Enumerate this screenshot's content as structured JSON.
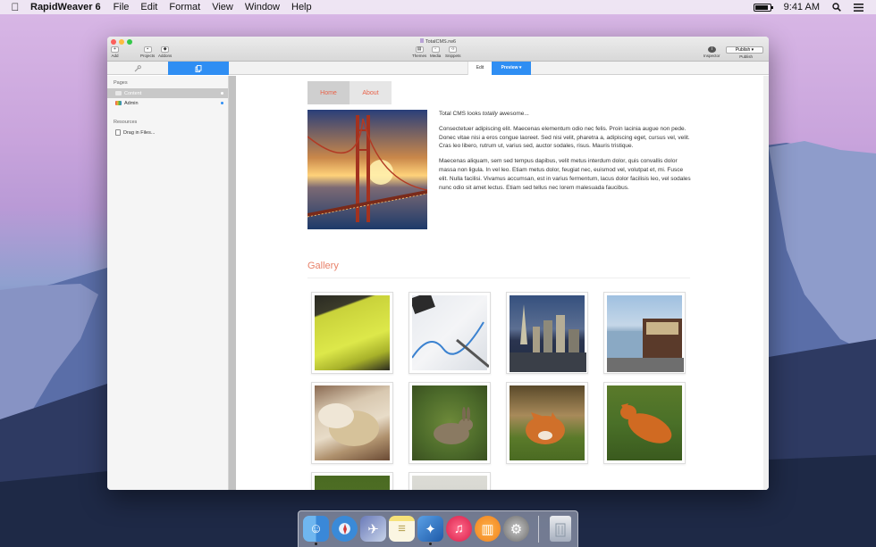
{
  "menubar": {
    "app_name": "RapidWeaver 6",
    "menus": [
      "File",
      "Edit",
      "Format",
      "View",
      "Window",
      "Help"
    ],
    "time": "9:41 AM"
  },
  "window": {
    "document_title": "TotalCMS.rw6",
    "toolbar_left": [
      {
        "label": "Add",
        "icon": "plus-icon"
      },
      {
        "label": "Projects",
        "icon": "projects-icon"
      },
      {
        "label": "Addons",
        "icon": "addons-icon"
      }
    ],
    "toolbar_center": [
      {
        "label": "Themes",
        "icon": "themes-icon"
      },
      {
        "label": "Media",
        "icon": "media-icon"
      },
      {
        "label": "Snippets",
        "icon": "snippets-icon"
      }
    ],
    "toolbar_right": {
      "inspector_label": "Inspector",
      "publish_label": "Publish",
      "publish_button": "Publish"
    },
    "tabs": {
      "edit_label": "Edit",
      "preview_label": "Preview"
    }
  },
  "sidebar": {
    "pages_heading": "Pages",
    "pages": [
      {
        "label": "Content",
        "selected": true
      },
      {
        "label": "Admin",
        "selected": false
      }
    ],
    "resources_heading": "Resources",
    "resources": [
      {
        "label": "Drag in Files..."
      }
    ]
  },
  "site": {
    "nav": [
      {
        "label": "Home",
        "active": true
      },
      {
        "label": "About",
        "active": false
      }
    ],
    "intro_prefix": "Total CMS looks ",
    "intro_em": "totally",
    "intro_suffix": " awesome...",
    "paragraph_1": "Consectetuer adipiscing elit. Maecenas elementum odio nec felis. Proin lacinia augue non pede. Donec vitae nisi a eros congue laoreet. Sed nisi velit, pharetra a, adipiscing eget, cursus vel, velit. Cras leo libero, rutrum ut, varius sed, auctor sodales, risus. Mauris tristique.",
    "paragraph_2": "Maecenas aliquam, sem sed tempus dapibus, velit metus interdum dolor, quis convallis dolor massa non ligula. In vel leo. Etiam metus dolor, feugiat nec, euismod vel, volutpat et, mi. Fusce elit. Nulla facilisi. Vivamus accumsan, est in varius fermentum, lacus dolor facilisis leo, vel sodales nunc odio sit amet lectus. Etiam sed tellus nec lorem malesuada faucibus.",
    "gallery_title": "Gallery"
  },
  "dock": {
    "apps": [
      "finder-icon",
      "safari-icon",
      "preview-icon",
      "notes-icon",
      "rapidweaver-icon",
      "itunes-icon",
      "ibooks-icon",
      "system-preferences-icon",
      "trash-icon"
    ]
  },
  "colors": {
    "accent_blue": "#2f8ef3",
    "nav_link": "#e8634a",
    "gallery_title": "#e8826a"
  }
}
